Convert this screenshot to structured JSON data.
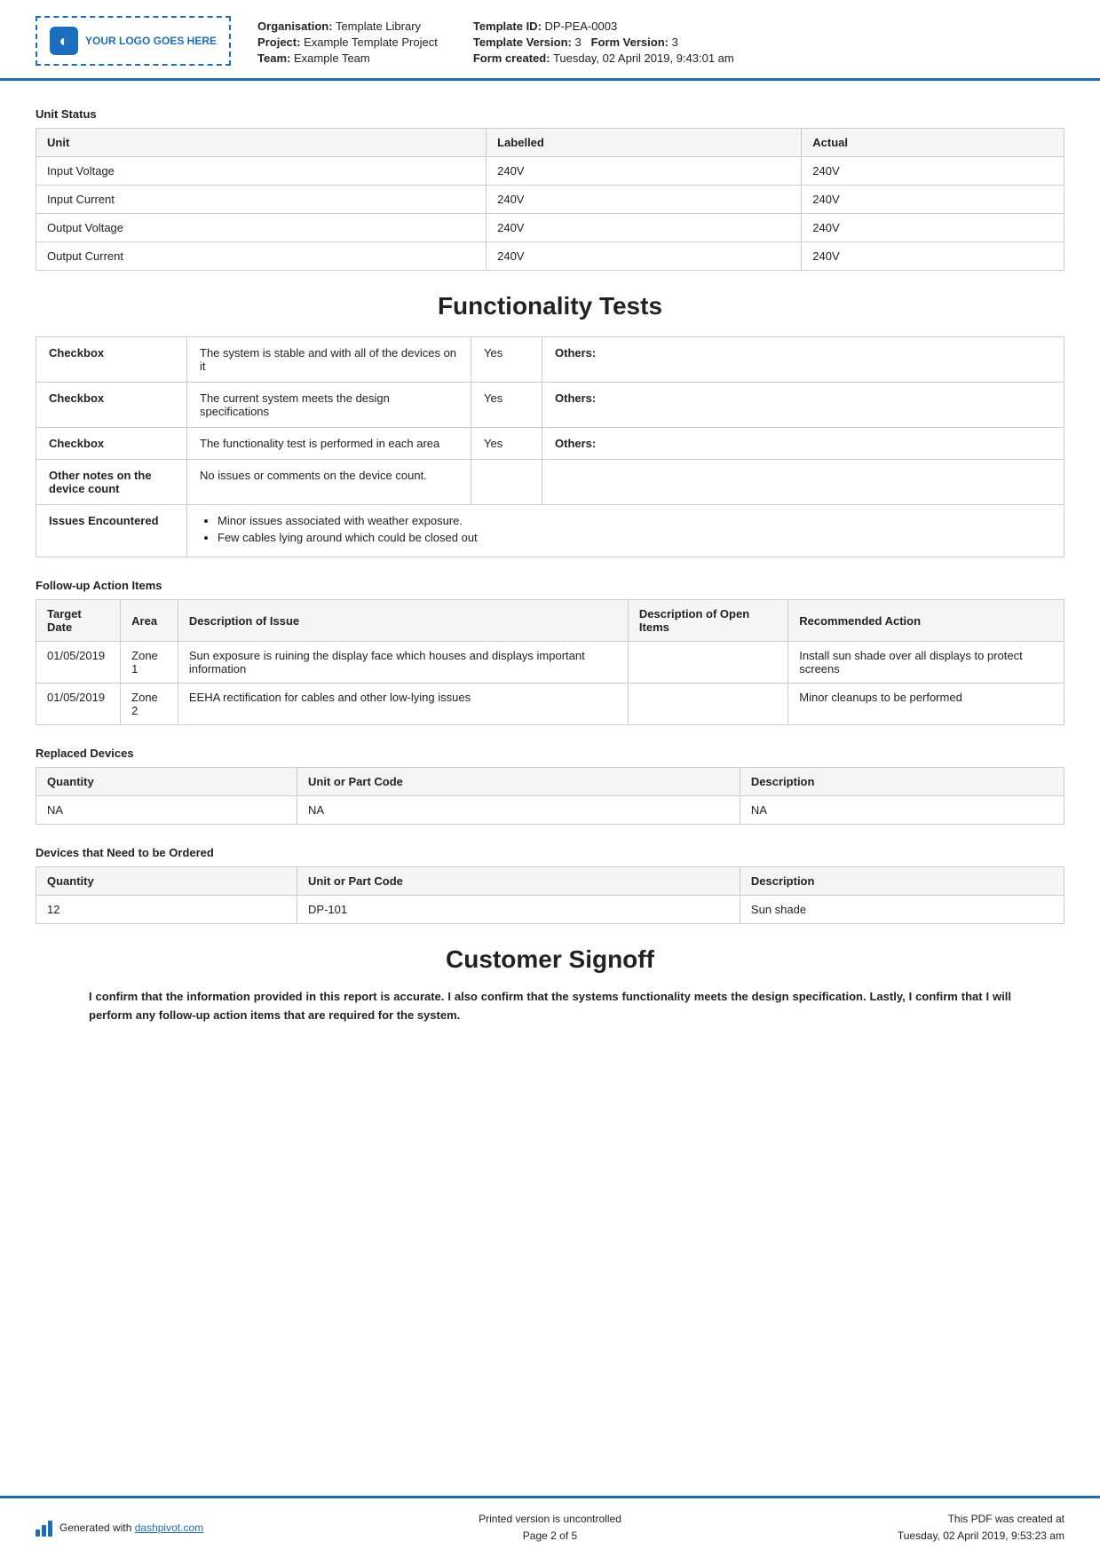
{
  "header": {
    "logo_text": "YOUR LOGO GOES HERE",
    "org_label": "Organisation:",
    "org_value": "Template Library",
    "project_label": "Project:",
    "project_value": "Example Template Project",
    "team_label": "Team:",
    "team_value": "Example Team",
    "template_id_label": "Template ID:",
    "template_id_value": "DP-PEA-0003",
    "template_version_label": "Template Version:",
    "template_version_value": "3",
    "form_version_label": "Form Version:",
    "form_version_value": "3",
    "form_created_label": "Form created:",
    "form_created_value": "Tuesday, 02 April 2019, 9:43:01 am"
  },
  "unit_status": {
    "section_label": "Unit Status",
    "columns": [
      "Unit",
      "Labelled",
      "Actual"
    ],
    "rows": [
      [
        "Input Voltage",
        "240V",
        "240V"
      ],
      [
        "Input Current",
        "240V",
        "240V"
      ],
      [
        "Output Voltage",
        "240V",
        "240V"
      ],
      [
        "Output Current",
        "240V",
        "240V"
      ]
    ]
  },
  "functionality_tests": {
    "heading": "Functionality Tests",
    "rows": [
      {
        "label": "Checkbox",
        "description": "The system is stable and with all of the devices on it",
        "value": "Yes",
        "others_label": "Others:"
      },
      {
        "label": "Checkbox",
        "description": "The current system meets the design specifications",
        "value": "Yes",
        "others_label": "Others:"
      },
      {
        "label": "Checkbox",
        "description": "The functionality test is performed in each area",
        "value": "Yes",
        "others_label": "Others:"
      },
      {
        "label": "Other notes on the device count",
        "description": "No issues or comments on the device count.",
        "value": "",
        "others_label": ""
      },
      {
        "label": "Issues Encountered",
        "issues": [
          "Minor issues associated with weather exposure.",
          "Few cables lying around which could be closed out"
        ]
      }
    ]
  },
  "followup": {
    "section_label": "Follow-up Action Items",
    "columns": [
      "Target Date",
      "Area",
      "Description of Issue",
      "Description of Open Items",
      "Recommended Action"
    ],
    "rows": [
      {
        "target_date": "01/05/2019",
        "area": "Zone 1",
        "description": "Sun exposure is ruining the display face which houses and displays important information",
        "open_items": "",
        "recommended": "Install sun shade over all displays to protect screens"
      },
      {
        "target_date": "01/05/2019",
        "area": "Zone 2",
        "description": "EEHA rectification for cables and other low-lying issues",
        "open_items": "",
        "recommended": "Minor cleanups to be performed"
      }
    ]
  },
  "replaced_devices": {
    "section_label": "Replaced Devices",
    "columns": [
      "Quantity",
      "Unit or Part Code",
      "Description"
    ],
    "rows": [
      [
        "NA",
        "NA",
        "NA"
      ]
    ]
  },
  "devices_to_order": {
    "section_label": "Devices that Need to be Ordered",
    "columns": [
      "Quantity",
      "Unit or Part Code",
      "Description"
    ],
    "rows": [
      [
        "12",
        "DP-101",
        "Sun shade"
      ]
    ]
  },
  "signoff": {
    "heading": "Customer Signoff",
    "text": "I confirm that the information provided in this report is accurate. I also confirm that the systems functionality meets the design specification. Lastly, I confirm that I will perform any follow-up action items that are required for the system."
  },
  "footer": {
    "generated_text": "Generated with",
    "link_text": "dashpivot.com",
    "center_line1": "Printed version is uncontrolled",
    "center_line2": "Page 2 of 5",
    "right_line1": "This PDF was created at",
    "right_line2": "Tuesday, 02 April 2019, 9:53:23 am"
  }
}
